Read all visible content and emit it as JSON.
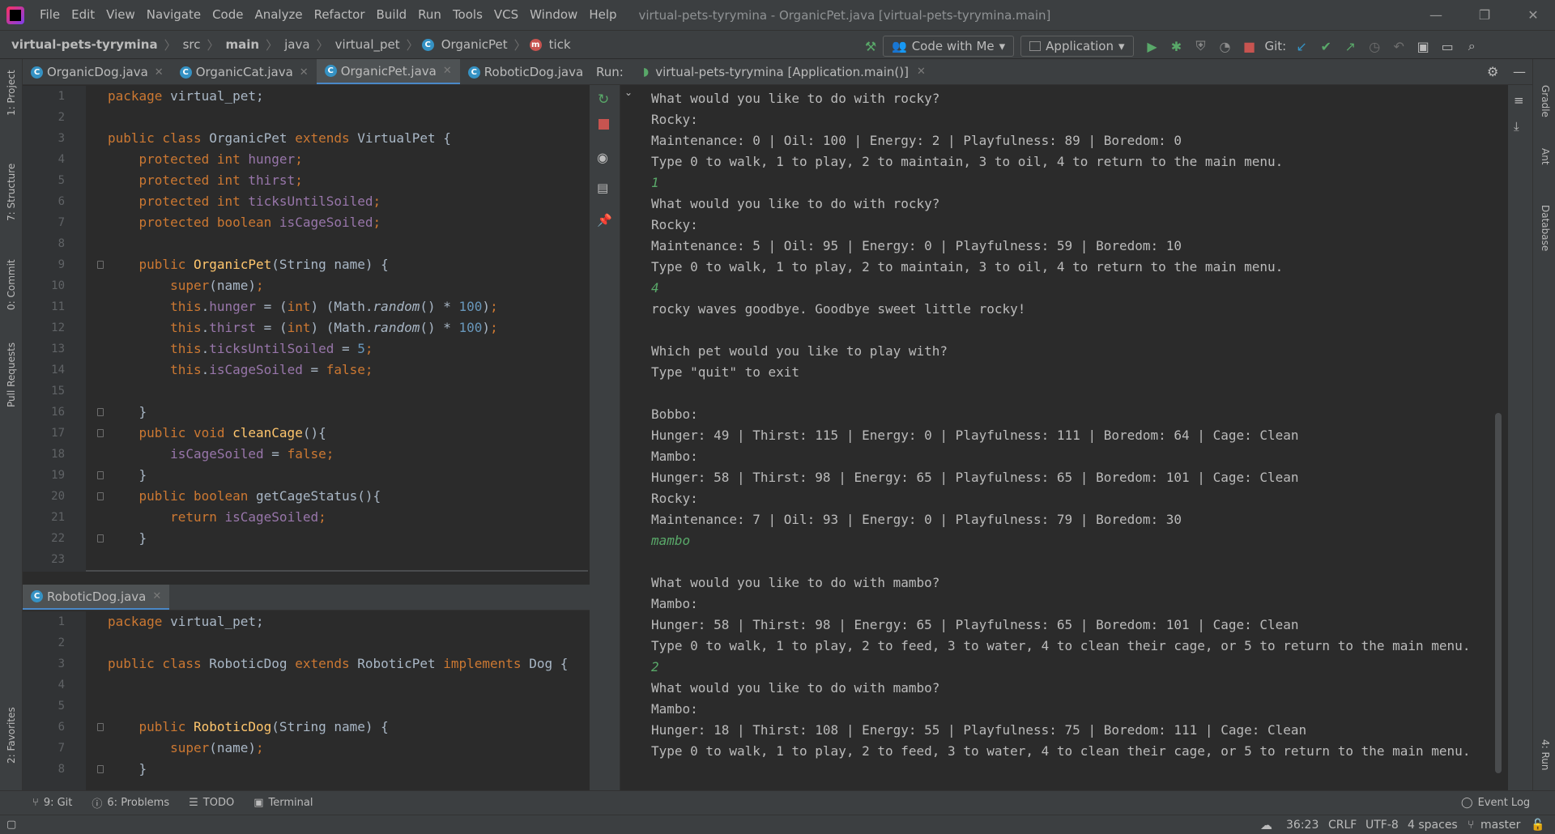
{
  "menu": [
    "File",
    "Edit",
    "View",
    "Navigate",
    "Code",
    "Analyze",
    "Refactor",
    "Build",
    "Run",
    "Tools",
    "VCS",
    "Window",
    "Help"
  ],
  "window_title": "virtual-pets-tyrymina - OrganicPet.java [virtual-pets-tyrymina.main]",
  "breadcrumbs": [
    "virtual-pets-tyrymina",
    "src",
    "main",
    "java",
    "virtual_pet",
    "OrganicPet",
    "tick"
  ],
  "toolbar": {
    "code_with_me": "Code with Me",
    "run_config": "Application",
    "git_label": "Git:"
  },
  "top_tabs": [
    "OrganicDog.java",
    "OrganicCat.java",
    "OrganicPet.java",
    "RoboticDog.java"
  ],
  "bottom_tab": "RoboticDog.java",
  "run": {
    "label": "Run:",
    "tab": "virtual-pets-tyrymina [Application.main()]"
  },
  "left_strip": [
    "1: Project",
    "7: Structure",
    "0: Commit",
    "Pull Requests",
    "2: Favorites"
  ],
  "right_strip": [
    "Gradle",
    "Ant",
    "Database",
    "4: Run"
  ],
  "editor_top": [
    {
      "n": "1",
      "t": [
        [
          "kw",
          "package "
        ],
        [
          "",
          "virtual_pet;"
        ]
      ]
    },
    {
      "n": "2",
      "t": []
    },
    {
      "n": "3",
      "t": [
        [
          "kw",
          "public class "
        ],
        [
          "",
          "OrganicPet "
        ],
        [
          "kw",
          "extends "
        ],
        [
          "",
          "VirtualPet {"
        ]
      ]
    },
    {
      "n": "4",
      "t": [
        [
          "",
          "    "
        ],
        [
          "kw",
          "protected int "
        ],
        [
          "fld",
          "hunger"
        ],
        [
          "kw",
          ";"
        ]
      ]
    },
    {
      "n": "5",
      "t": [
        [
          "",
          "    "
        ],
        [
          "kw",
          "protected int "
        ],
        [
          "fld",
          "thirst"
        ],
        [
          "kw",
          ";"
        ]
      ]
    },
    {
      "n": "6",
      "t": [
        [
          "",
          "    "
        ],
        [
          "kw",
          "protected int "
        ],
        [
          "fld",
          "ticksUntilSoiled"
        ],
        [
          "kw",
          ";"
        ]
      ]
    },
    {
      "n": "7",
      "t": [
        [
          "",
          "    "
        ],
        [
          "kw",
          "protected boolean "
        ],
        [
          "fld",
          "isCageSoiled"
        ],
        [
          "kw",
          ";"
        ]
      ]
    },
    {
      "n": "8",
      "t": []
    },
    {
      "n": "9",
      "t": [
        [
          "",
          "    "
        ],
        [
          "kw",
          "public "
        ],
        [
          "fn",
          "OrganicPet"
        ],
        [
          "",
          "(String name) {"
        ]
      ]
    },
    {
      "n": "10",
      "t": [
        [
          "",
          "        "
        ],
        [
          "kw",
          "super"
        ],
        [
          "",
          "(name)"
        ],
        [
          "kw",
          ";"
        ]
      ]
    },
    {
      "n": "11",
      "t": [
        [
          "",
          "        "
        ],
        [
          "kw",
          "this"
        ],
        [
          "",
          "."
        ],
        [
          "fld",
          "hunger "
        ],
        [
          "",
          "= ("
        ],
        [
          "kw",
          "int"
        ],
        [
          "",
          ") (Math."
        ],
        [
          "ital",
          "random"
        ],
        [
          "",
          "() * "
        ],
        [
          "num",
          "100"
        ],
        [
          "",
          ")"
        ],
        [
          "kw",
          ";"
        ]
      ]
    },
    {
      "n": "12",
      "t": [
        [
          "",
          "        "
        ],
        [
          "kw",
          "this"
        ],
        [
          "",
          "."
        ],
        [
          "fld",
          "thirst "
        ],
        [
          "",
          "= ("
        ],
        [
          "kw",
          "int"
        ],
        [
          "",
          ") (Math."
        ],
        [
          "ital",
          "random"
        ],
        [
          "",
          "() * "
        ],
        [
          "num",
          "100"
        ],
        [
          "",
          ")"
        ],
        [
          "kw",
          ";"
        ]
      ]
    },
    {
      "n": "13",
      "t": [
        [
          "",
          "        "
        ],
        [
          "kw",
          "this"
        ],
        [
          "",
          "."
        ],
        [
          "fld",
          "ticksUntilSoiled "
        ],
        [
          "",
          "= "
        ],
        [
          "num",
          "5"
        ],
        [
          "kw",
          ";"
        ]
      ]
    },
    {
      "n": "14",
      "t": [
        [
          "",
          "        "
        ],
        [
          "kw",
          "this"
        ],
        [
          "",
          "."
        ],
        [
          "fld",
          "isCageSoiled "
        ],
        [
          "",
          "= "
        ],
        [
          "kw",
          "false;"
        ]
      ]
    },
    {
      "n": "15",
      "t": []
    },
    {
      "n": "16",
      "t": [
        [
          "",
          "    }"
        ]
      ]
    },
    {
      "n": "17",
      "t": [
        [
          "",
          "    "
        ],
        [
          "kw",
          "public void "
        ],
        [
          "fn",
          "cleanCage"
        ],
        [
          "",
          "(){"
        ]
      ]
    },
    {
      "n": "18",
      "t": [
        [
          "",
          "        "
        ],
        [
          "fld",
          "isCageSoiled "
        ],
        [
          "",
          "= "
        ],
        [
          "kw",
          "false;"
        ]
      ]
    },
    {
      "n": "19",
      "t": [
        [
          "",
          "    }"
        ]
      ]
    },
    {
      "n": "20",
      "t": [
        [
          "",
          "    "
        ],
        [
          "kw",
          "public boolean "
        ],
        [
          "",
          "getCageStatus(){"
        ]
      ]
    },
    {
      "n": "21",
      "t": [
        [
          "",
          "        "
        ],
        [
          "kw",
          "return "
        ],
        [
          "fld",
          "isCageSoiled"
        ],
        [
          "kw",
          ";"
        ]
      ]
    },
    {
      "n": "22",
      "t": [
        [
          "",
          "    }"
        ]
      ]
    },
    {
      "n": "23",
      "t": []
    }
  ],
  "editor_bottom": [
    {
      "n": "1",
      "t": [
        [
          "kw",
          "package "
        ],
        [
          "",
          "virtual_pet;"
        ]
      ]
    },
    {
      "n": "2",
      "t": []
    },
    {
      "n": "3",
      "t": [
        [
          "kw",
          "public class "
        ],
        [
          "",
          "RoboticDog "
        ],
        [
          "kw",
          "extends "
        ],
        [
          "",
          "RoboticPet "
        ],
        [
          "kw",
          "implements "
        ],
        [
          "",
          "Dog {"
        ]
      ]
    },
    {
      "n": "4",
      "t": []
    },
    {
      "n": "5",
      "t": []
    },
    {
      "n": "6",
      "t": [
        [
          "",
          "    "
        ],
        [
          "kw",
          "public "
        ],
        [
          "fn",
          "RoboticDog"
        ],
        [
          "",
          "(String name) {"
        ]
      ]
    },
    {
      "n": "7",
      "t": [
        [
          "",
          "        "
        ],
        [
          "kw",
          "super"
        ],
        [
          "",
          "(name)"
        ],
        [
          "kw",
          ";"
        ]
      ]
    },
    {
      "n": "8",
      "t": [
        [
          "",
          "    }"
        ]
      ]
    }
  ],
  "console": [
    {
      "t": "What would you like to do with rocky?"
    },
    {
      "t": "Rocky:"
    },
    {
      "t": "Maintenance: 0 | Oil: 100 | Energy: 2 | Playfulness: 89 | Boredom: 0"
    },
    {
      "t": "Type 0 to walk, 1 to play, 2 to maintain, 3 to oil, 4 to return to the main menu."
    },
    {
      "t": "1",
      "input": true
    },
    {
      "t": "What would you like to do with rocky?"
    },
    {
      "t": "Rocky:"
    },
    {
      "t": "Maintenance: 5 | Oil: 95 | Energy: 0 | Playfulness: 59 | Boredom: 10"
    },
    {
      "t": "Type 0 to walk, 1 to play, 2 to maintain, 3 to oil, 4 to return to the main menu."
    },
    {
      "t": "4",
      "input": true
    },
    {
      "t": "rocky waves goodbye. Goodbye sweet little rocky!"
    },
    {
      "t": ""
    },
    {
      "t": "Which pet would you like to play with?"
    },
    {
      "t": "Type \"quit\" to exit"
    },
    {
      "t": ""
    },
    {
      "t": "Bobbo:"
    },
    {
      "t": "Hunger: 49 | Thirst: 115 | Energy: 0 | Playfulness: 111 | Boredom: 64 | Cage: Clean"
    },
    {
      "t": "Mambo:"
    },
    {
      "t": "Hunger: 58 | Thirst: 98 | Energy: 65 | Playfulness: 65 | Boredom: 101 | Cage: Clean"
    },
    {
      "t": "Rocky:"
    },
    {
      "t": "Maintenance: 7 | Oil: 93 | Energy: 0 | Playfulness: 79 | Boredom: 30"
    },
    {
      "t": "mambo",
      "input": true
    },
    {
      "t": ""
    },
    {
      "t": "What would you like to do with mambo?"
    },
    {
      "t": "Mambo:"
    },
    {
      "t": "Hunger: 58 | Thirst: 98 | Energy: 65 | Playfulness: 65 | Boredom: 101 | Cage: Clean"
    },
    {
      "t": "Type 0 to walk, 1 to play, 2 to feed, 3 to water, 4 to clean their cage, or 5 to return to the main menu."
    },
    {
      "t": "2",
      "input": true
    },
    {
      "t": "What would you like to do with mambo?"
    },
    {
      "t": "Mambo:"
    },
    {
      "t": "Hunger: 18 | Thirst: 108 | Energy: 55 | Playfulness: 75 | Boredom: 111 | Cage: Clean"
    },
    {
      "t": "Type 0 to walk, 1 to play, 2 to feed, 3 to water, 4 to clean their cage, or 5 to return to the main menu."
    }
  ],
  "bottom_tools": [
    "9: Git",
    "6: Problems",
    "TODO",
    "Terminal"
  ],
  "event_log": "Event Log",
  "status": {
    "position": "36:23",
    "line_sep": "CRLF",
    "encoding": "UTF-8",
    "indent": "4 spaces",
    "branch": "master"
  }
}
